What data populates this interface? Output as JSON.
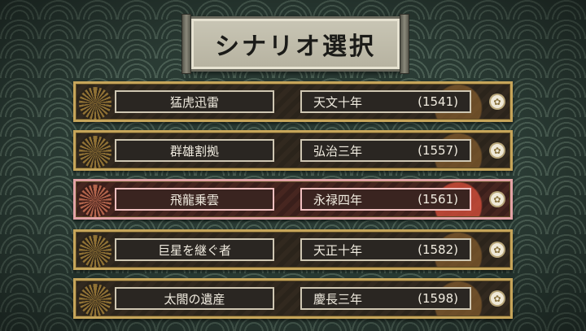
{
  "title": "シナリオ選択",
  "scenarios": [
    {
      "name": "猛虎迅雷",
      "era": "天文十年",
      "year": "(1541)",
      "selected": false
    },
    {
      "name": "群雄割拠",
      "era": "弘治三年",
      "year": "(1557)",
      "selected": false
    },
    {
      "name": "飛龍乗雲",
      "era": "永禄四年",
      "year": "(1561)",
      "selected": true
    },
    {
      "name": "巨星を継ぐ者",
      "era": "天正十年",
      "year": "(1582)",
      "selected": false
    },
    {
      "name": "太閤の遺産",
      "era": "慶長三年",
      "year": "(1598)",
      "selected": false
    }
  ],
  "colors": {
    "frame_gold": "#c6a55a",
    "frame_selected": "#e3a3a6",
    "background": "#2a3b34"
  }
}
